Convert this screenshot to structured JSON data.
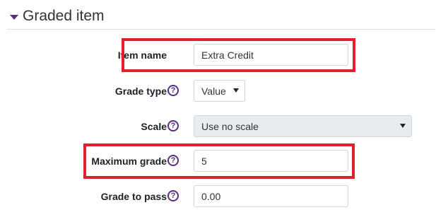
{
  "section": {
    "title": "Graded item"
  },
  "fields": {
    "item_name": {
      "label": "Item name",
      "value": "Extra Credit"
    },
    "grade_type": {
      "label": "Grade type",
      "value": "Value"
    },
    "scale": {
      "label": "Scale",
      "value": "Use no scale"
    },
    "maximum_grade": {
      "label": "Maximum grade",
      "value": "5"
    },
    "grade_to_pass": {
      "label": "Grade to pass",
      "value": "0.00"
    }
  },
  "icons": {
    "help": "help-icon",
    "collapse": "caret-down-icon"
  },
  "colors": {
    "accent": "#5b2d86",
    "highlight": "#e0202a"
  }
}
